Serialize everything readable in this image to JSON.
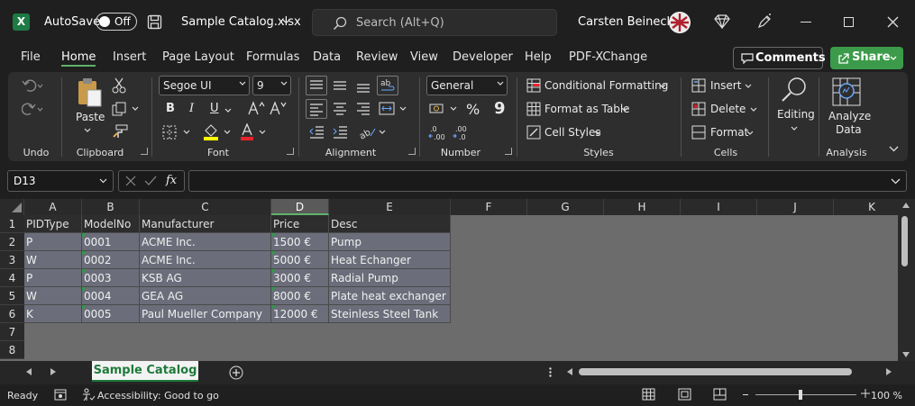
{
  "titlebar": {
    "autosave_label": "AutoSave",
    "autosave_state": "Off",
    "file_name": "Sample Catalog.xlsx",
    "search_placeholder": "Search (Alt+Q)",
    "user_name": "Carsten Beinecke",
    "logo_letter": "X"
  },
  "menu": {
    "items": [
      "File",
      "Home",
      "Insert",
      "Page Layout",
      "Formulas",
      "Data",
      "Review",
      "View",
      "Developer",
      "Help",
      "PDF-XChange"
    ],
    "active": "Home",
    "comments_label": "Comments",
    "share_label": "Share"
  },
  "ribbon": {
    "undo_label": "Undo",
    "clipboard": {
      "label": "Clipboard",
      "paste": "Paste"
    },
    "font": {
      "label": "Font",
      "name": "Segoe UI",
      "size": "9",
      "bold": "B",
      "italic": "I",
      "underline": "U"
    },
    "alignment": {
      "label": "Alignment"
    },
    "number": {
      "label": "Number",
      "format": "General",
      "percent": "%",
      "comma": "9"
    },
    "styles": {
      "label": "Styles",
      "conditional": "Conditional Formatting",
      "table": "Format as Table",
      "cell_styles": "Cell Styles"
    },
    "cells": {
      "label": "Cells",
      "insert": "Insert",
      "delete": "Delete",
      "format": "Format"
    },
    "editing": {
      "label": "Editing"
    },
    "analysis": {
      "label": "Analysis",
      "analyze_line1": "Analyze",
      "analyze_line2": "Data"
    }
  },
  "formula_bar": {
    "name_box": "D13",
    "fx": "fx",
    "formula": ""
  },
  "sheet": {
    "columns": [
      "A",
      "B",
      "C",
      "D",
      "E",
      "F",
      "G",
      "H",
      "I",
      "J",
      "K"
    ],
    "selected_column": "D",
    "rows": [
      "1",
      "2",
      "3",
      "4",
      "5",
      "6",
      "7",
      "8"
    ],
    "header": [
      "PIDType",
      "ModelNo",
      "Manufacturer",
      "Price",
      "Desc"
    ],
    "data": [
      [
        "P",
        "0001",
        "ACME Inc.",
        "1500 €",
        "Pump"
      ],
      [
        "W",
        "0002",
        "ACME Inc.",
        "5000 €",
        "Heat Echanger"
      ],
      [
        "P",
        "0003",
        "KSB AG",
        "3000 €",
        "Radial Pump"
      ],
      [
        "W",
        "0004",
        "GEA AG",
        "8000 €",
        "Plate heat exchanger"
      ],
      [
        "K",
        "0005",
        "Paul Mueller Company",
        "12000 €",
        "Steinless Steel Tank"
      ]
    ]
  },
  "tabs": {
    "active": "Sample Catalog"
  },
  "status": {
    "ready": "Ready",
    "accessibility": "Accessibility: Good to go",
    "zoom": "100 %"
  }
}
